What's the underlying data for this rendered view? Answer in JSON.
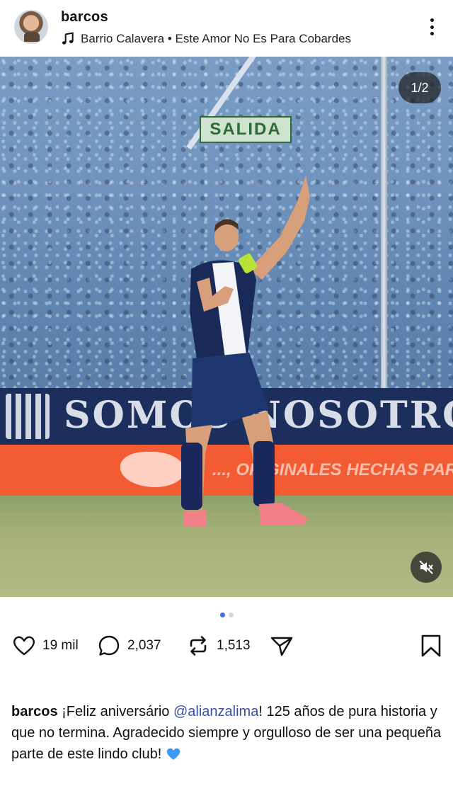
{
  "post": {
    "username": "barcos",
    "music": "Barrio Calavera • Este Amor No Es Para Cobardes",
    "page_indicator": "1/2",
    "media": {
      "sign_text": "SALIDA",
      "banner_text": "SOMOS NOSOTROS",
      "ad_text": "..., ORIGINALES HECHAS PARA"
    },
    "carousel": {
      "total": 2,
      "active": 1
    },
    "stats": {
      "likes": "19 mil",
      "comments": "2,037",
      "reposts": "1,513"
    },
    "caption": {
      "user": "barcos",
      "text_before": " ¡Feliz aniversário ",
      "mention": "@alianzalima",
      "text_after": "! 125 años de pura historia y que no termina. Agradecido siempre y orgulloso de ser una pequeña parte de este lindo club! ",
      "emoji": "blue-heart"
    }
  },
  "icons": {
    "music": "music-note-icon",
    "more": "more-vertical-icon",
    "mute": "speaker-muted-icon",
    "like": "heart-icon",
    "comment": "comment-bubble-icon",
    "repost": "repost-arrows-icon",
    "share": "send-paper-plane-icon",
    "save": "bookmark-icon"
  },
  "colors": {
    "mention": "#3750a8",
    "active_dot": "#3d6ff0",
    "heart_emoji": "#3b9bf5"
  }
}
